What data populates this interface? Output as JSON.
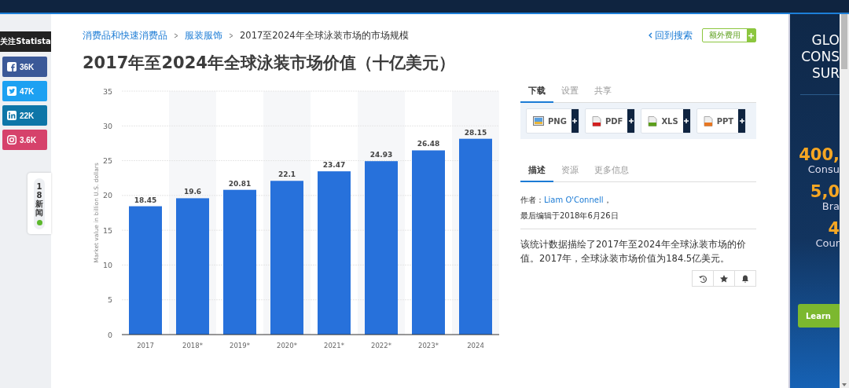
{
  "sidebar": {
    "follow_label": "关注Statista",
    "social": [
      {
        "kind": "facebook",
        "count": "36K",
        "color": "#3b5998"
      },
      {
        "kind": "twitter",
        "count": "47K",
        "color": "#1da1f2"
      },
      {
        "kind": "linkedin",
        "count": "22K",
        "color": "#0e76a8"
      },
      {
        "kind": "instagram",
        "count": "3.6K",
        "color": "#d6426b"
      }
    ],
    "news_widget": {
      "label": "18新闻"
    }
  },
  "breadcrumb": [
    {
      "label": "消费品和快速消费品",
      "link": true
    },
    {
      "label": "服装服饰",
      "link": true
    },
    {
      "label": "2017至2024年全球泳装市场的市场规模",
      "link": false
    }
  ],
  "back_link": "回到搜索",
  "extra_button": "额外费用",
  "title": "2017年至2024年全球泳装市场价值（十亿美元）",
  "chart": {
    "chart_data": {
      "type": "bar",
      "ylabel": "Market value in billion U.S. dollars",
      "categories": [
        "2017",
        "2018*",
        "2019*",
        "2020*",
        "2021*",
        "2022*",
        "2023*",
        "2024"
      ],
      "series": [
        {
          "color": "#2771db",
          "values": [
            18.45,
            19.6,
            20.81,
            22.1,
            23.47,
            24.93,
            26.48,
            28.15
          ]
        }
      ],
      "ylim": [
        0,
        35
      ],
      "yticks": [
        0,
        5,
        10,
        15,
        20,
        25,
        30,
        35
      ],
      "data_labels": true,
      "grid": true
    }
  },
  "tools_tabs": [
    {
      "label": "下载",
      "selected": true
    },
    {
      "label": "设置",
      "selected": false
    },
    {
      "label": "共享",
      "selected": false
    }
  ],
  "downloads": [
    {
      "kind": "png",
      "label": "PNG"
    },
    {
      "kind": "pdf",
      "label": "PDF"
    },
    {
      "kind": "xls",
      "label": "XLS"
    },
    {
      "kind": "ppt",
      "label": "PPT"
    }
  ],
  "info_tabs": [
    {
      "label": "描述",
      "selected": true
    },
    {
      "label": "资源",
      "selected": false
    },
    {
      "label": "更多信息",
      "selected": false
    }
  ],
  "author": {
    "prefix": "作者：",
    "name": "Liam O'Connell",
    "suffix": "，"
  },
  "edited": "最后编辑于2018年6月26日",
  "description": "该统计数据描绘了2017年至2024年全球泳装市场的价值。2017年，全球泳装市场价值为184.5亿美元。",
  "actions": [
    {
      "kind": "history"
    },
    {
      "kind": "star"
    },
    {
      "kind": "bell"
    }
  ],
  "ad": {
    "headline": [
      "GLO",
      "CONS",
      "SUR"
    ],
    "stats": [
      {
        "value": "400,",
        "label": "Consu"
      },
      {
        "value": "5,0",
        "label": "Bra"
      },
      {
        "value": "4",
        "label": "Cour"
      }
    ],
    "button": "Learn"
  }
}
